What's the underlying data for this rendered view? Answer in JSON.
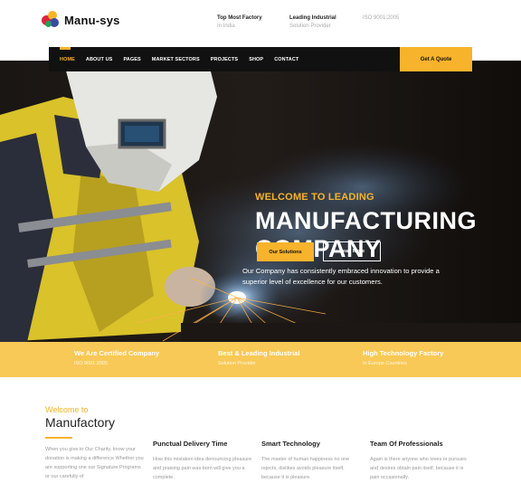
{
  "brand": {
    "name": "Manu-sys"
  },
  "header_info": [
    {
      "title": "Top Most Factory",
      "sub": "In India"
    },
    {
      "title": "Leading Industrial",
      "sub": "Solution Provider"
    },
    {
      "title": "",
      "sub": "ISO 9001:2005"
    }
  ],
  "nav": {
    "items": [
      "HOME",
      "ABOUT US",
      "PAGES",
      "MARKET SECTORS",
      "PROJECTS",
      "SHOP",
      "CONTACT"
    ],
    "active": "HOME",
    "cta": "Get A Quote"
  },
  "hero": {
    "kicker": "WELCOME TO LEADING",
    "title_line1": "MANUFACTURING",
    "title_line2": "COMPANY",
    "description": "Our Company has consistently embraced innovation to provide a superior level of excellence for our customers.",
    "btn_primary": "Our Solutions",
    "btn_secondary": "Read More"
  },
  "band": [
    {
      "title": "We Are Certified Company",
      "sub": "ISO 9001:2005"
    },
    {
      "title": "Best & Leading Industrial",
      "sub": "Solution Provider"
    },
    {
      "title": "High Technology Factory",
      "sub": "In Europe Countries"
    }
  ],
  "about": {
    "kicker": "Welcome to",
    "title": "Manufactory",
    "text": "When you give to Our Charity, know your donation is making a difference Whether you are supporting one our Signature Programs or our carefully of"
  },
  "features": [
    {
      "title": "Punctual Delivery Time",
      "text": "How this mistaken idea denouncing pleasure and praising pain was born will give you a complete."
    },
    {
      "title": "Smart Technology",
      "text": "The master of human happiness no one rejects, dislikes avoids pleasure itself, because it is pleasure."
    },
    {
      "title": "Team Of Professionals",
      "text": "Again is there anyone who loves or pursues and desires obtain pain itself, because it is pain occasionally."
    }
  ],
  "colors": {
    "accent": "#f7b32b",
    "band": "#f8c956",
    "nav_bg": "#111111"
  }
}
